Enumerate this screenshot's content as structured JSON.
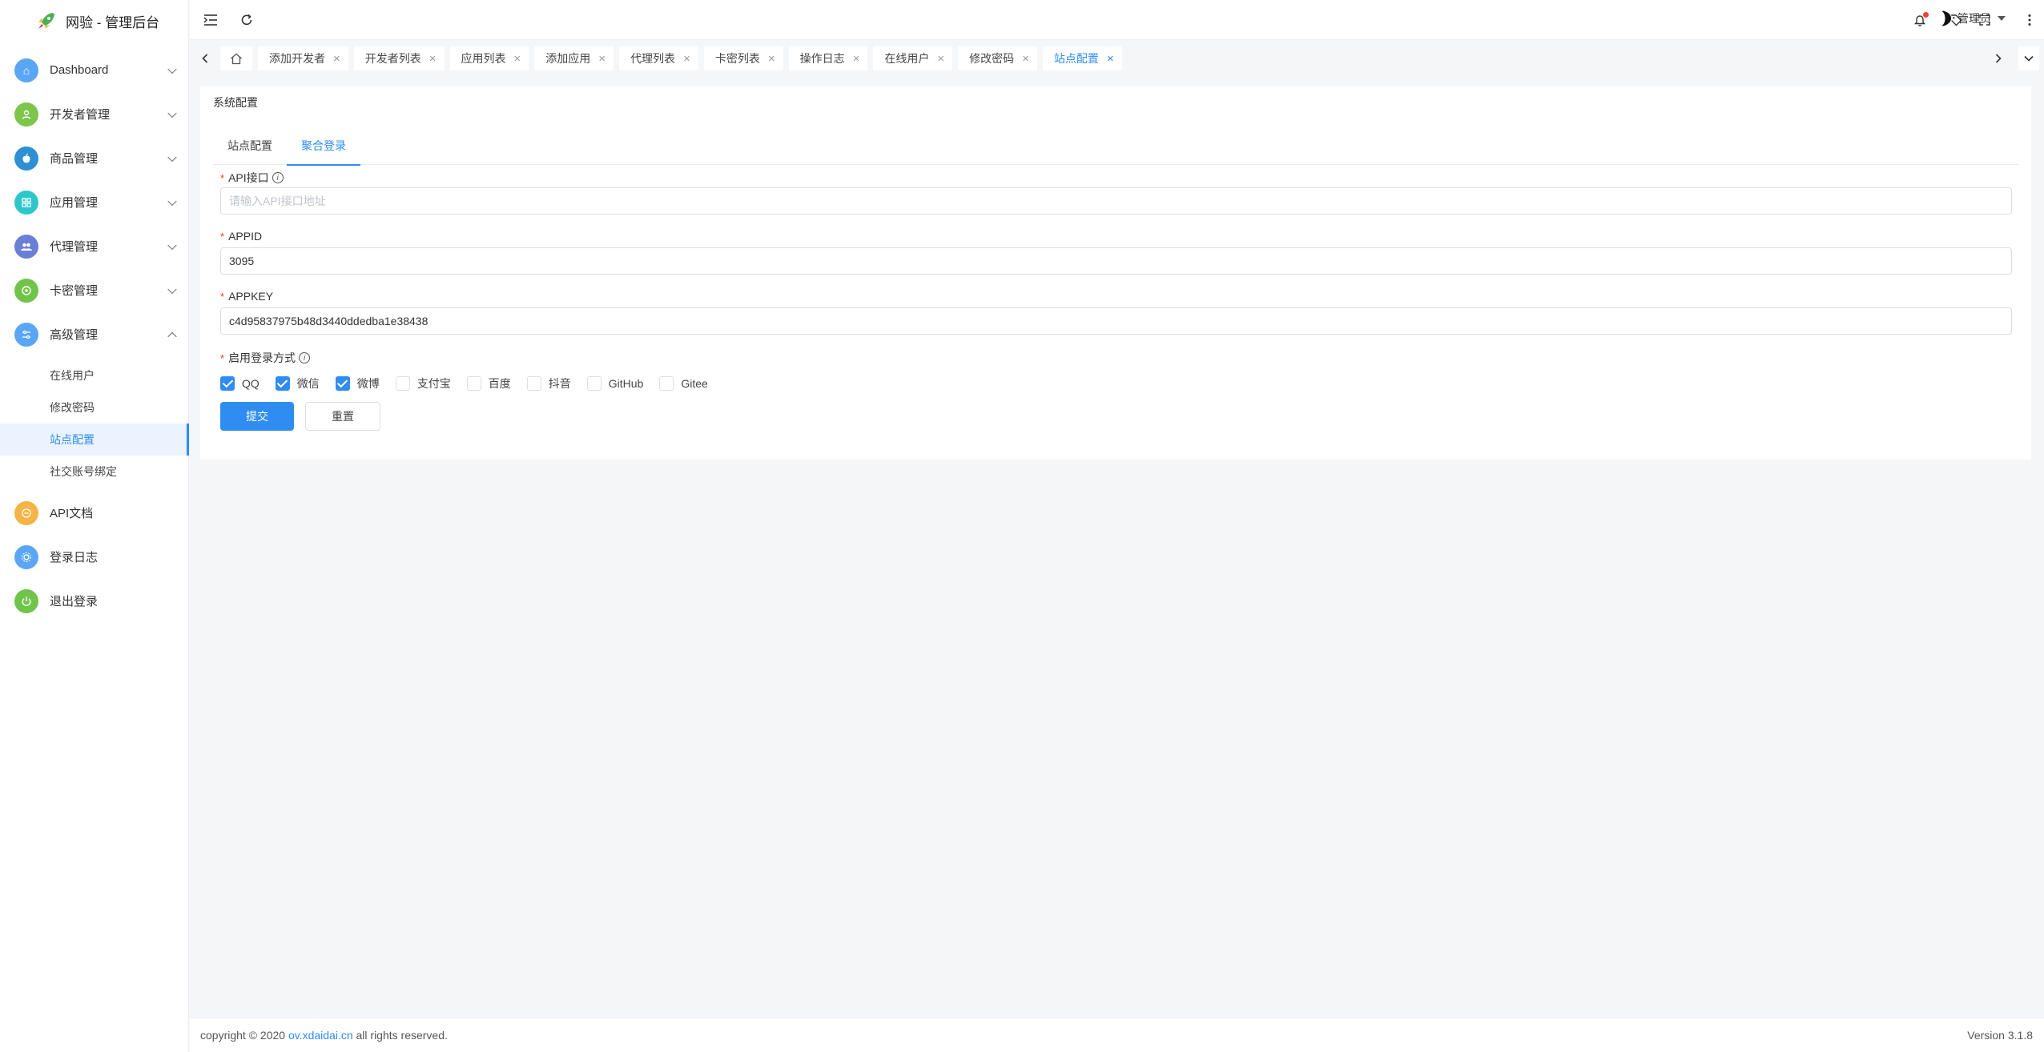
{
  "brand": {
    "title": "网验 - 管理后台"
  },
  "sidebar": {
    "items": [
      {
        "label": "Dashboard",
        "icon": "home-icon",
        "color": "#5aa6f5"
      },
      {
        "label": "开发者管理",
        "icon": "user-icon",
        "color": "#7cc64b"
      },
      {
        "label": "商品管理",
        "icon": "apple-icon",
        "color": "#2d8fd4"
      },
      {
        "label": "应用管理",
        "icon": "app-icon",
        "color": "#2ec7c9"
      },
      {
        "label": "代理管理",
        "icon": "group-icon",
        "color": "#6a7fd6"
      },
      {
        "label": "卡密管理",
        "icon": "card-icon",
        "color": "#70c44a"
      },
      {
        "label": "高级管理",
        "icon": "settings-icon",
        "color": "#5aa6f5"
      }
    ],
    "sub_items": [
      "在线用户",
      "修改密码",
      "站点配置",
      "社交账号绑定"
    ],
    "bottom_items": [
      {
        "label": "API文档",
        "icon": "doc-icon",
        "color": "#f5b445"
      },
      {
        "label": "登录日志",
        "icon": "log-icon",
        "color": "#5aa6f5"
      },
      {
        "label": "退出登录",
        "icon": "power-icon",
        "color": "#70c44a"
      }
    ]
  },
  "header": {
    "user_label": "管理员"
  },
  "tabs": [
    "添加开发者",
    "开发者列表",
    "应用列表",
    "添加应用",
    "代理列表",
    "卡密列表",
    "操作日志",
    "在线用户",
    "修改密码",
    "站点配置"
  ],
  "card": {
    "title": "系统配置",
    "subtabs": [
      "站点配置",
      "聚合登录"
    ]
  },
  "form": {
    "api_label": "API接口",
    "api_placeholder": "请输入API接口地址",
    "api_value": "",
    "appid_label": "APPID",
    "appid_value": "3095",
    "appkey_label": "APPKEY",
    "appkey_value": "c4d95837975b48d3440ddedba1e38438",
    "methods_label": "启用登录方式",
    "methods": [
      {
        "label": "QQ",
        "checked": true
      },
      {
        "label": "微信",
        "checked": true
      },
      {
        "label": "微博",
        "checked": true
      },
      {
        "label": "支付宝",
        "checked": false
      },
      {
        "label": "百度",
        "checked": false
      },
      {
        "label": "抖音",
        "checked": false
      },
      {
        "label": "GitHub",
        "checked": false
      },
      {
        "label": "Gitee",
        "checked": false
      }
    ],
    "submit_label": "提交",
    "reset_label": "重置"
  },
  "footer": {
    "copyright_prefix": "copyright © 2020",
    "link_text": "ov.xdaidai.cn",
    "copyright_suffix": "all rights reserved.",
    "version": "Version 3.1.8"
  }
}
